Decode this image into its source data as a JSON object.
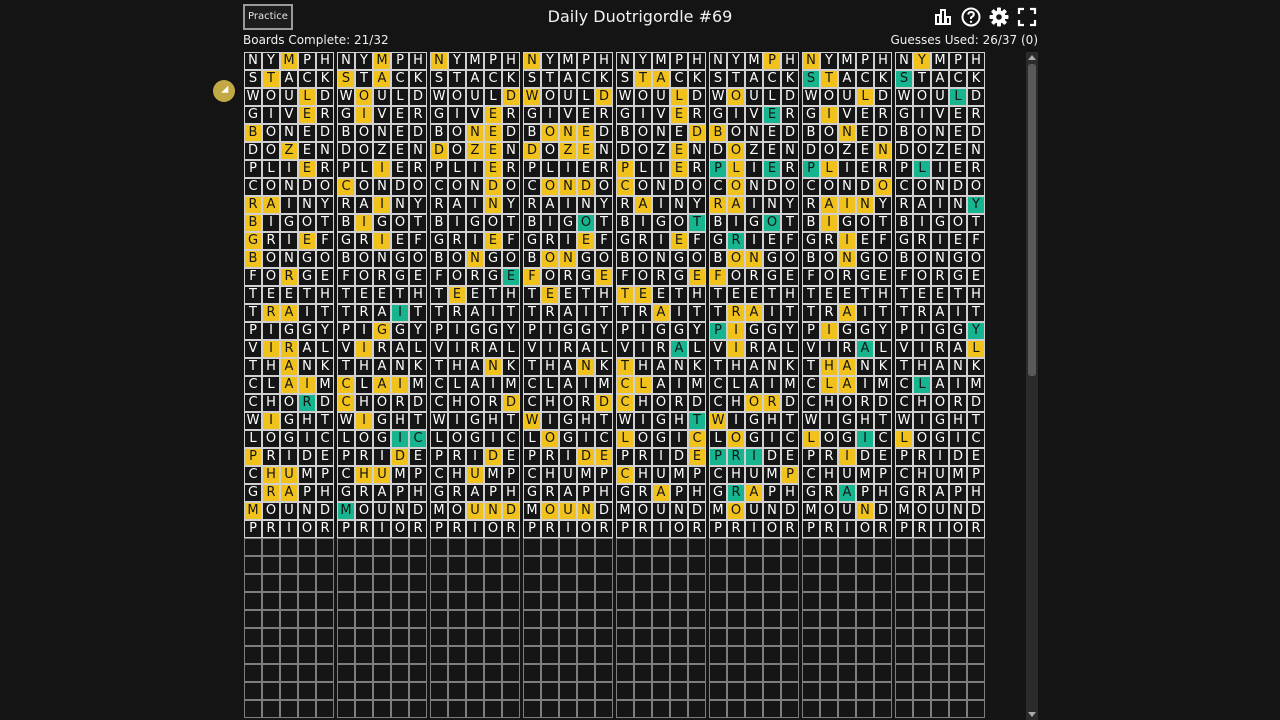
{
  "header": {
    "practice_label": "Practice",
    "title": "Daily Duotrigordle #69",
    "icons": [
      "stats-icon",
      "help-icon",
      "settings-icon",
      "fullscreen-icon"
    ]
  },
  "status": {
    "boards_complete": "Boards Complete: 21/32",
    "guesses_used": "Guesses Used: 26/37 (0)"
  },
  "colors": {
    "present": "#f1c21b",
    "correct": "#16b58f",
    "background": "#141414"
  },
  "guesses": [
    "NYMPH",
    "STACK",
    "WOULD",
    "GIVER",
    "BONED",
    "DOZEN",
    "PLIER",
    "CONDO",
    "RAINY",
    "BIGOT",
    "GRIEF",
    "BONGO",
    "FORGE",
    "TEETH",
    "TRAIT",
    "PIGGY",
    "VIRAL",
    "THANK",
    "CLAIM",
    "CHORD",
    "WIGHT",
    "LOGIC",
    "PRIDE",
    "CHUMP",
    "GRAPH",
    "MOUND",
    "PRIOR"
  ],
  "empty_rows": 10,
  "boards": [
    {
      "hints": [
        "..y..",
        ".y...",
        "...y.",
        "...y.",
        "y....",
        "..y..",
        "...y.",
        ".....",
        "yy...",
        "y....",
        "y..y.",
        "y....",
        "..y..",
        ".....",
        ".yy..",
        ".....",
        ".yy..",
        "..y..",
        "..yy.",
        "...g.",
        ".y...",
        ".....",
        "y....",
        ".yy..",
        ".yy..",
        "y....",
        "....."
      ]
    },
    {
      "hints": [
        "..y..",
        "y.y..",
        ".y...",
        ".y...",
        ".....",
        ".....",
        "..y..",
        "y....",
        "..y..",
        ".y...",
        "..y..",
        ".....",
        ".....",
        ".....",
        "...g.",
        "..y..",
        ".y...",
        ".....",
        "y.yy.",
        "y....",
        ".y...",
        "...gg",
        "...y.",
        ".yy..",
        ".....",
        "g....",
        "....."
      ]
    },
    {
      "hints": [
        "y....",
        ".....",
        "....y",
        "...y.",
        "..yy.",
        "y.yy.",
        "...y.",
        "...y.",
        "...y.",
        ".....",
        "...y.",
        "..y..",
        "....g",
        ".y...",
        ".....",
        ".....",
        ".....",
        "...y.",
        ".....",
        "....y",
        ".....",
        ".....",
        "...y.",
        "..y..",
        ".....",
        "..yyy",
        "....."
      ]
    },
    {
      "hints": [
        "y....",
        ".....",
        "y...y",
        ".....",
        ".yyy.",
        "y.yy.",
        ".....",
        ".yyy.",
        ".....",
        "...g.",
        "...y.",
        ".yy..",
        "y...y",
        ".y...",
        ".....",
        ".....",
        ".....",
        "...y.",
        ".....",
        "....y",
        "y....",
        ".y...",
        "...yy",
        ".....",
        ".....",
        ".yyy.",
        "....."
      ]
    },
    {
      "hints": [
        ".....",
        ".yy..",
        "...y.",
        "...y.",
        "....y",
        "...y.",
        "y..y.",
        "y....",
        ".y...",
        "....g",
        "...y.",
        ".....",
        "....y",
        "yy...",
        "..y..",
        ".....",
        "...g.",
        "y....",
        "yy...",
        "y....",
        "....g",
        "y...y",
        "....y",
        "y....",
        "..y..",
        ".....",
        "....."
      ]
    },
    {
      "hints": [
        "...y.",
        ".....",
        ".y...",
        "...g.",
        "y....",
        ".y...",
        "gy.g.",
        ".y...",
        "yy...",
        "...g.",
        ".g...",
        ".yy..",
        "y....",
        ".....",
        ".yy..",
        "gy...",
        ".y...",
        ".....",
        ".....",
        "..yy.",
        "y....",
        ".y...",
        "ggg..",
        "....y",
        ".gy..",
        ".y...",
        "....."
      ]
    },
    {
      "hints": [
        "y....",
        "gy...",
        "...y.",
        ".y...",
        "..y..",
        "....y",
        "gy...",
        "....y",
        ".yyy.",
        ".y...",
        "..y..",
        "..y..",
        ".....",
        ".....",
        "..y..",
        ".y...",
        "...g.",
        ".yy..",
        ".yy..",
        ".....",
        ".....",
        "y..g.",
        "..y..",
        ".....",
        "..g..",
        "...y.",
        "....."
      ]
    },
    {
      "hints": [
        ".y...",
        "g....",
        "...g.",
        ".....",
        ".....",
        ".....",
        ".g...",
        ".....",
        "....g",
        ".....",
        ".....",
        ".....",
        ".....",
        ".....",
        ".....",
        "....g",
        "....y",
        ".....",
        ".g...",
        ".....",
        ".....",
        "y....",
        ".....",
        ".....",
        ".....",
        ".....",
        "....."
      ]
    }
  ]
}
